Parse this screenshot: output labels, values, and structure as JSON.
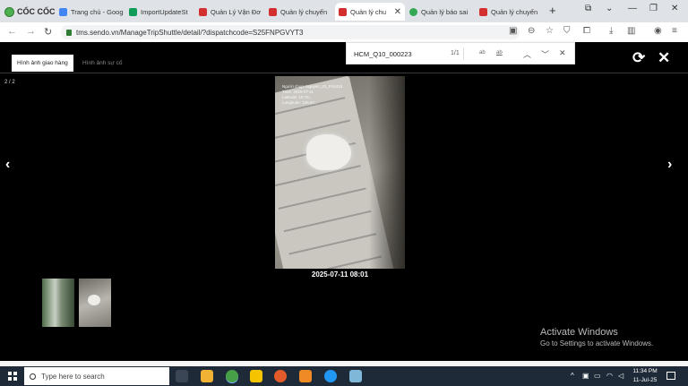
{
  "browser": {
    "brand": "CỐC CỐC",
    "tabs": [
      {
        "label": "Trang chủ - Goog",
        "color": "#4285f4",
        "active": false
      },
      {
        "label": "ImportUpdateSt",
        "color": "#0f9d58",
        "active": false
      },
      {
        "label": "Quản Lý Vận Đơ",
        "color": "#d32f2f",
        "active": false
      },
      {
        "label": "Quản lý chuyến",
        "color": "#d32f2f",
        "active": false
      },
      {
        "label": "Quản lý chu",
        "color": "#d32f2f",
        "active": true
      },
      {
        "label": "Quản lý báo sai",
        "color": "#34a853",
        "active": false
      },
      {
        "label": "Quản lý chuyến",
        "color": "#d32f2f",
        "active": false
      }
    ],
    "url": "tms.sendo.vn/ManageTripShuttle/detail/?dispatchcode=S25FNPGVYT3"
  },
  "find": {
    "query": "HCM_Q10_000223",
    "count": "1/1",
    "opt_case": "ab",
    "opt_word": "ab"
  },
  "viewer": {
    "tab_active": "Hình ảnh giao hàng",
    "tab_inactive": "Hình ảnh sự cố",
    "counter": "2 / 2",
    "photo_timestamp": "2025-07-11 08:01",
    "watermark": [
      "Người chụp: Nguyen_23_P44415",
      "Time: 2025-07-11",
      "Latitude: 10.76...",
      "Longitude: 106.67..."
    ]
  },
  "os": {
    "activate_title": "Activate Windows",
    "activate_sub": "Go to Settings to activate Windows.",
    "search_placeholder": "Type here to search",
    "time": "11:34 PM",
    "date": "11-Jul-25"
  }
}
